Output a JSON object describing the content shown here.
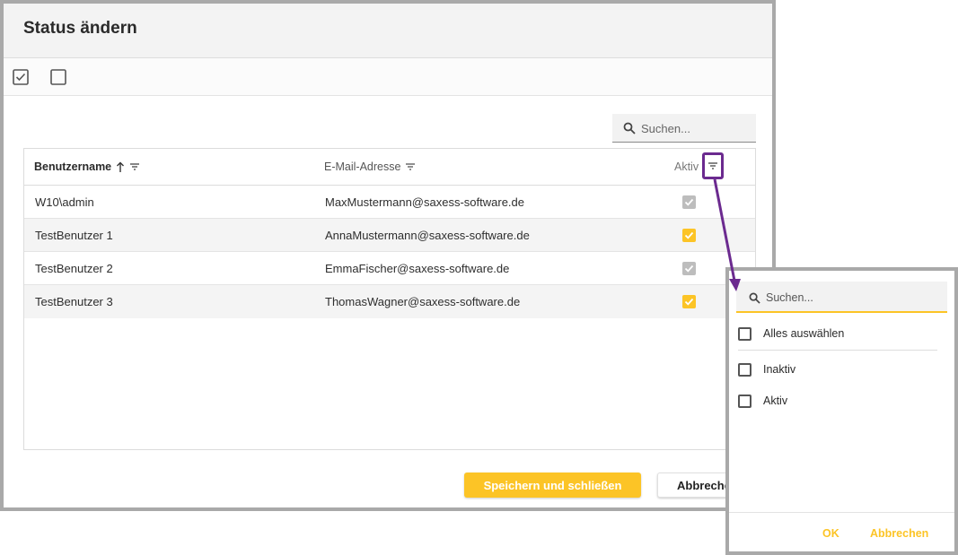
{
  "dialog": {
    "title": "Status ändern",
    "toolbar": {
      "check_all_icon": "checkbox-checked-icon",
      "uncheck_all_icon": "checkbox-empty-icon"
    },
    "search": {
      "placeholder": "Suchen..."
    },
    "columns": [
      {
        "label": "Benutzername",
        "sort": "ascending"
      },
      {
        "label": "E-Mail-Adresse"
      },
      {
        "label": "Aktiv"
      }
    ],
    "rows": [
      {
        "user": " W10\\admin",
        "email": " MaxMustermann@saxess-software.de",
        "active": true,
        "editable": false
      },
      {
        "user": "TestBenutzer 1",
        "email": "AnnaMustermann@saxess-software.de",
        "active": true,
        "editable": true
      },
      {
        "user": "TestBenutzer 2",
        "email": "EmmaFischer@saxess-software.de",
        "active": true,
        "editable": false
      },
      {
        "user": "TestBenutzer 3",
        "email": "ThomasWagner@saxess-software.de",
        "active": true,
        "editable": true
      }
    ],
    "buttons": {
      "save": "Speichern und schließen",
      "cancel": "Abbrechen"
    }
  },
  "filter_popup": {
    "search_placeholder": "Suchen...",
    "select_all": "Alles auswählen",
    "options": [
      "Inaktiv",
      "Aktiv"
    ],
    "ok": "OK",
    "cancel": "Abbrechen"
  },
  "colors": {
    "accent": "#fcc426",
    "highlight": "#6b2a8f",
    "frame": "#a9a9a9"
  }
}
